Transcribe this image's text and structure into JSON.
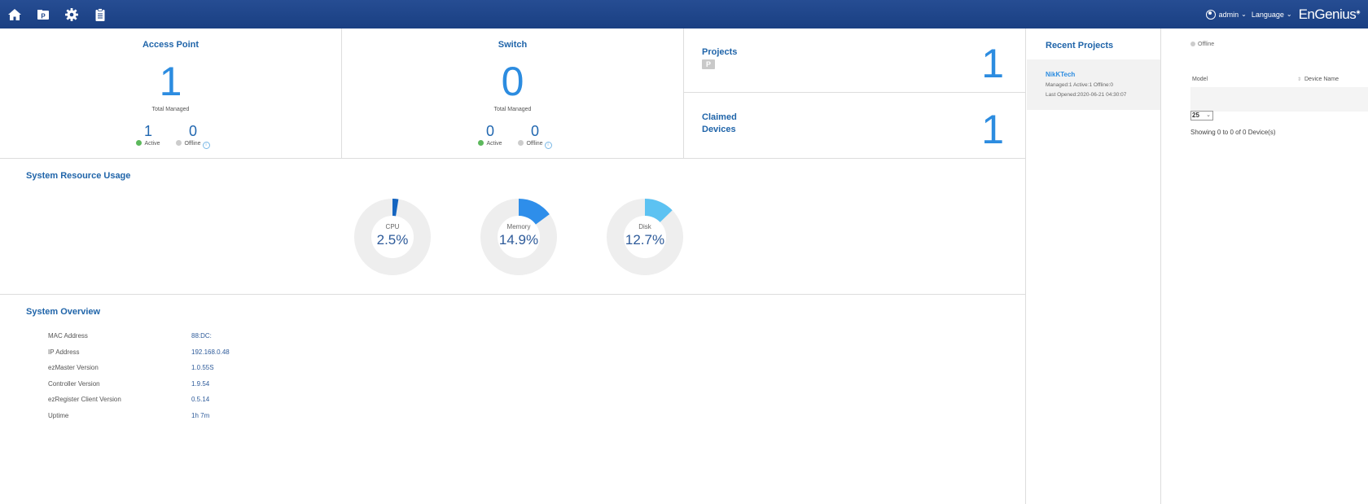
{
  "topbar": {
    "icons": [
      "home-icon",
      "project-icon",
      "gear-icon",
      "clipboard-icon"
    ],
    "user": "admin",
    "language": "Language",
    "brand": "EnGenius"
  },
  "access_point": {
    "title": "Access Point",
    "total": "1",
    "total_label": "Total Managed",
    "active": "1",
    "active_label": "Active",
    "offline": "0",
    "offline_label": "Offline"
  },
  "switch": {
    "title": "Switch",
    "total": "0",
    "total_label": "Total Managed",
    "active": "0",
    "active_label": "Active",
    "offline": "0",
    "offline_label": "Offline"
  },
  "projects": {
    "title": "Projects",
    "icon_letter": "P",
    "count": "1"
  },
  "claimed": {
    "title_line1": "Claimed",
    "title_line2": "Devices",
    "count": "1"
  },
  "resources": {
    "title": "System Resource Usage",
    "items": [
      {
        "label": "CPU",
        "value": "2.5%",
        "fraction": 0.025,
        "color": "#1565c0"
      },
      {
        "label": "Memory",
        "value": "14.9%",
        "fraction": 0.149,
        "color": "#2e8eea"
      },
      {
        "label": "Disk",
        "value": "12.7%",
        "fraction": 0.127,
        "color": "#5cc2f2"
      }
    ]
  },
  "overview": {
    "title": "System Overview",
    "rows": [
      {
        "label": "MAC Address",
        "value": "88:DC:"
      },
      {
        "label": "IP Address",
        "value": "192.168.0.48"
      },
      {
        "label": "ezMaster Version",
        "value": "1.0.55S"
      },
      {
        "label": "Controller Version",
        "value": "1.9.54"
      },
      {
        "label": "ezRegister Client Version",
        "value": "0.5.14"
      },
      {
        "label": "Uptime",
        "value": "1h 7m"
      }
    ]
  },
  "recent_projects": {
    "title": "Recent Projects",
    "item": {
      "name": "NikKTech",
      "stats": "Managed:1   Active:1   Offline:0",
      "last_opened": "Last Opened:2020-06-21 04:30:07"
    }
  },
  "devices": {
    "legend_offline": "Offline",
    "col_model": "Model",
    "col_device_name": "Device Name",
    "page_size": "25",
    "showing": "Showing 0 to 0 of 0 Device(s)"
  },
  "colors": {
    "topbar": "#1f4589",
    "accent": "#2c8ce0",
    "title": "#1f64a9",
    "active_dot": "#5cb85c",
    "offline_dot": "#cccccc"
  }
}
